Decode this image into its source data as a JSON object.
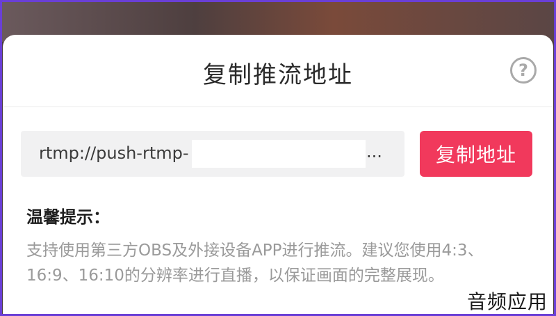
{
  "dialog": {
    "title": "复制推流地址",
    "help_icon": "question-circle-icon",
    "help_glyph": "?"
  },
  "stream_url": {
    "prefix": "rtmp://push-rtmp-",
    "ellipsis": "..."
  },
  "copy_button": {
    "label": "复制地址",
    "color": "#f1395c"
  },
  "tips": {
    "title": "温馨提示：",
    "body": "支持使用第三方OBS及外接设备APP进行推流。建议您使用4:3、16:9、16:10的分辨率进行直播，以保证画面的完整展现。"
  },
  "watermark": "音频应用"
}
